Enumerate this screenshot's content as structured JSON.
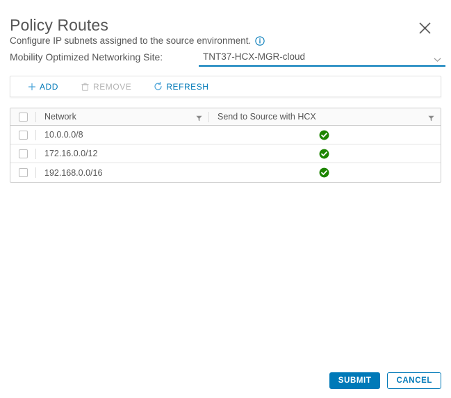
{
  "header": {
    "title": "Policy Routes",
    "subtitle": "Configure IP subnets assigned to the source environment.",
    "info_icon": "info-circle-icon",
    "close_icon": "close-icon"
  },
  "site_selector": {
    "label": "Mobility Optimized Networking Site:",
    "value": "TNT37-HCX-MGR-cloud",
    "chevron_icon": "chevron-down-icon",
    "underline_color": "#0079b8"
  },
  "toolbar": {
    "add": {
      "label": "ADD",
      "icon": "plus-icon",
      "enabled": true
    },
    "remove": {
      "label": "REMOVE",
      "icon": "trash-icon",
      "enabled": false
    },
    "refresh": {
      "label": "REFRESH",
      "icon": "refresh-icon",
      "enabled": true
    }
  },
  "table": {
    "columns": [
      {
        "label": "Network",
        "filter_icon": "funnel-icon"
      },
      {
        "label": "Send to Source with HCX",
        "filter_icon": "funnel-icon"
      }
    ],
    "rows": [
      {
        "network": "10.0.0.0/8",
        "send_to_source": "enabled",
        "status_icon": "check-circle-icon"
      },
      {
        "network": "172.16.0.0/12",
        "send_to_source": "enabled",
        "status_icon": "check-circle-icon"
      },
      {
        "network": "192.168.0.0/16",
        "send_to_source": "enabled",
        "status_icon": "check-circle-icon"
      }
    ]
  },
  "footer": {
    "submit_label": "SUBMIT",
    "cancel_label": "CANCEL"
  },
  "colors": {
    "accent_blue": "#0079b8",
    "status_green": "#1d8500",
    "text_gray": "#565656",
    "disabled_gray": "#b3b3b3"
  }
}
